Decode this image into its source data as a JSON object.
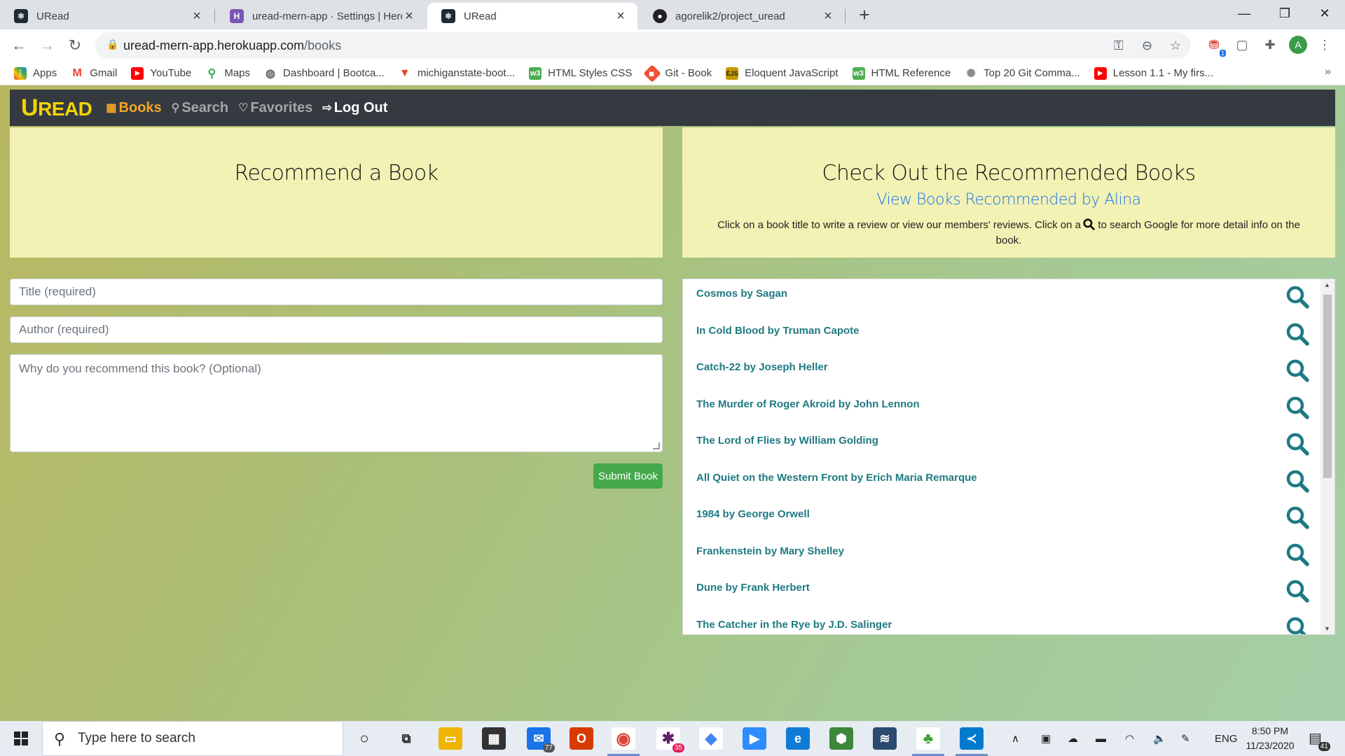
{
  "browser": {
    "tabs": [
      {
        "title": "URead",
        "icon": "react-icon",
        "color": "#1f2a37"
      },
      {
        "title": "uread-mern-app · Settings | Hero",
        "icon": "heroku-icon",
        "color": "#7b56b6"
      },
      {
        "title": "URead",
        "icon": "react-icon",
        "color": "#1f2a37"
      },
      {
        "title": "agorelik2/project_uread",
        "icon": "github-icon",
        "color": "#222222"
      }
    ],
    "active_tab": 2,
    "url_host": "uread-mern-app.herokuapp.com",
    "url_path": "/books",
    "profile_initial": "A",
    "extension_badge": "1",
    "bookmarks": [
      {
        "label": "Apps",
        "icon": "apps-grid-icon",
        "color": "#ea4335"
      },
      {
        "label": "Gmail",
        "icon": "gmail-icon",
        "color": "#ea4335"
      },
      {
        "label": "YouTube",
        "icon": "youtube-icon",
        "color": "#ff0000"
      },
      {
        "label": "Maps",
        "icon": "maps-icon",
        "color": "#34a853"
      },
      {
        "label": "Dashboard | Bootca...",
        "icon": "globe-icon",
        "color": "#5f6368"
      },
      {
        "label": "michiganstate-boot...",
        "icon": "gitlab-icon",
        "color": "#e24329"
      },
      {
        "label": "HTML Styles CSS",
        "icon": "w3schools-icon",
        "color": "#4caf50"
      },
      {
        "label": "Git - Book",
        "icon": "git-icon",
        "color": "#f05033"
      },
      {
        "label": "Eloquent JavaScript",
        "icon": "ejs-icon",
        "color": "#c59a00"
      },
      {
        "label": "HTML Reference",
        "icon": "w3schools-icon",
        "color": "#4caf50"
      },
      {
        "label": "Top 20 Git Comma...",
        "icon": "site-icon",
        "color": "#8a8a8a"
      },
      {
        "label": "Lesson 1.1 - My firs...",
        "icon": "youtube-icon",
        "color": "#ff0000"
      }
    ]
  },
  "app": {
    "brand_first": "U",
    "brand_rest": "READ",
    "nav": [
      {
        "label": "Books",
        "icon": "books-icon",
        "active": true
      },
      {
        "label": "Search",
        "icon": "search-icon",
        "active": false
      },
      {
        "label": "Favorites",
        "icon": "heart-icon",
        "active": false
      },
      {
        "label": "Log Out",
        "icon": "logout-icon",
        "active": false
      }
    ],
    "colors": {
      "brand": "#f5d300",
      "accent": "#f5a524",
      "link": "#1f7a82",
      "submit": "#45a94c"
    }
  },
  "recommend": {
    "heading": "Recommend a Book",
    "title_placeholder": "Title (required)",
    "author_placeholder": "Author (required)",
    "reason_placeholder": "Why do you recommend this book? (Optional)",
    "submit_label": "Submit Book"
  },
  "recommended": {
    "heading": "Check Out the Recommended Books",
    "sublink": "View Books Recommended by Alina",
    "instructions_before": "Click on a book title to write a review or view our members' reviews. Click on a",
    "instructions_after": "to search Google for more detail info on the book.",
    "books": [
      "Cosmos by Sagan",
      "In Cold Blood by Truman Capote",
      "Catch-22 by Joseph Heller",
      "The Murder of Roger Akroid by John Lennon",
      "The Lord of Flies by William Golding",
      "All Quiet on the Western Front by Erich Maria Remarque",
      "1984 by George Orwell",
      "Frankenstein by Mary Shelley",
      "Dune by Frank Herbert",
      "The Catcher in the Rye by J.D. Salinger"
    ]
  },
  "taskbar": {
    "search_placeholder": "Type here to search",
    "mail_badge": "77",
    "slack_badge": "35",
    "language": "ENG",
    "time": "8:50 PM",
    "date": "11/23/2020",
    "notification_count": "41"
  }
}
